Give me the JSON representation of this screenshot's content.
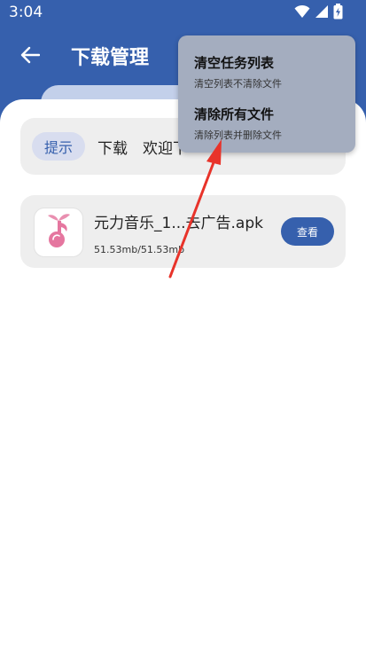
{
  "status_bar": {
    "time": "3:04"
  },
  "header": {
    "title": "下载管理"
  },
  "notice": {
    "badge": "提示",
    "text": "下载　欢迎下"
  },
  "download_item": {
    "file_name": "元力音乐_1...去广告.apk",
    "size": "51.53mb/51.53mb",
    "button_label": "查看"
  },
  "menu": {
    "items": [
      {
        "title": "清空任务列表",
        "subtitle": "清空列表不清除文件"
      },
      {
        "title": "清除所有文件",
        "subtitle": "清除列表并删除文件"
      }
    ]
  },
  "colors": {
    "primary": "#3660ad",
    "menu_bg": "#a4adbf",
    "annotation_arrow": "#e8332a",
    "card_bg": "#eeeeee"
  }
}
